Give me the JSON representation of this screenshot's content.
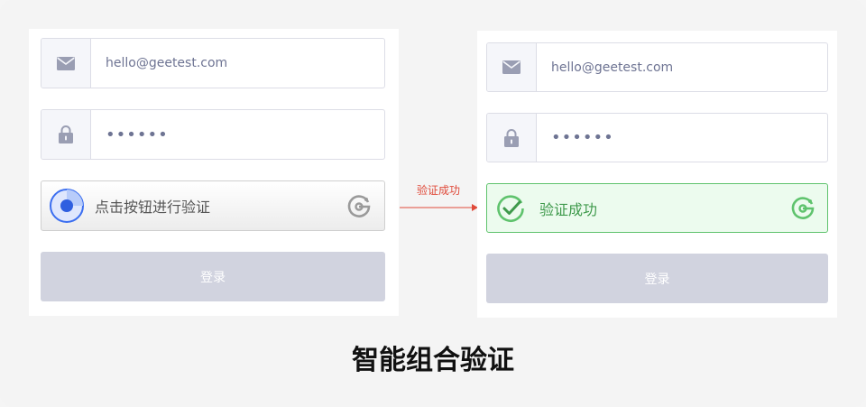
{
  "left_form": {
    "email": "hello@geetest.com",
    "password": "••••••",
    "captcha_label": "点击按钮进行验证",
    "login_label": "登录"
  },
  "transition": {
    "label": "验证成功"
  },
  "right_form": {
    "email": "hello@geetest.com",
    "password": "••••••",
    "captcha_label": "验证成功",
    "login_label": "登录"
  },
  "caption": "智能组合验证",
  "icons": {
    "email": "envelope-icon",
    "password": "lock-icon",
    "captcha_start": "captcha-radar-icon",
    "captcha_done": "check-circle-icon",
    "brand": "geetest-logo-icon"
  },
  "colors": {
    "success": "#5fc36d",
    "arrow": "#e04a3a",
    "button_disabled": "#d1d3df",
    "captcha_blue": "#3b6ef0"
  }
}
